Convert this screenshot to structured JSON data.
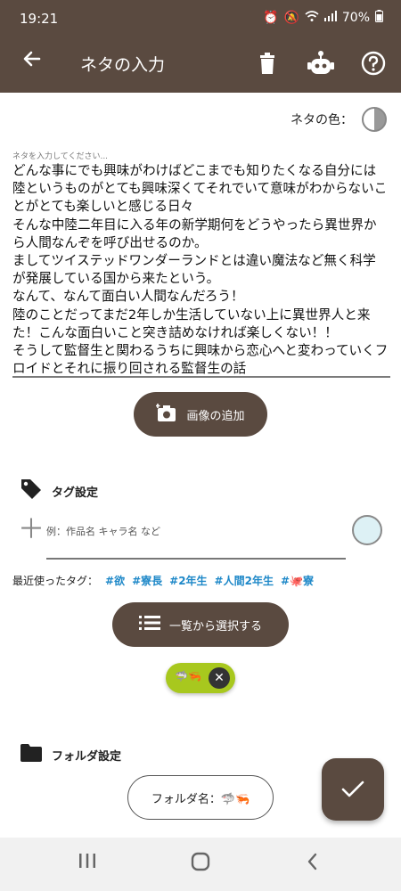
{
  "status_bar": {
    "time": "19:21",
    "battery": "70%"
  },
  "app_bar": {
    "title": "ネタの入力",
    "icons": [
      "back-arrow-icon",
      "trash-icon",
      "robot-icon",
      "help-icon"
    ]
  },
  "color_label": "ネタの色：",
  "memo": {
    "placeholder": "ネタを入力してください...",
    "text": "どんな事にでも興味がわけばどこまでも知りたくなる自分には陸というものがとても興味深くてそれでいて意味がわからないことがとても楽しいと感じる日々\nそんな中陸二年目に入る年の新学期何をどうやったら異世界から人間なんぞを呼び出せるのか。\nましてツイステッドワンダーランドとは違い魔法など無く科学が発展している国から来たという。\nなんて、なんて面白い人間なんだろう！\n陸のことだってまだ2年しか生活していない上に異世界人と来た！こんな面白いこと突き詰めなければ楽しくない！！\nそうして監督生と関わるうちに興味から恋心へと変わっていくフロイドとそれに振り回される監督生の話"
  },
  "add_image_label": "画像の追加",
  "tag_section": {
    "title": "タグ設定",
    "input_placeholder": "例：作品名 キャラ名 など",
    "recent_label": "最近使ったタグ：",
    "recent_tags": [
      "#欲",
      "#寮長",
      "#2年生",
      "#人間2年生",
      "#🐙寮"
    ],
    "select_list_label": "一覧から選択する",
    "chip_label": "🦈🦐"
  },
  "folder_section": {
    "title": "フォルダ設定",
    "button_label": "フォルダ名：🦈🦐"
  },
  "colors": {
    "primary": "#5a4a40",
    "tag_link": "#1e88c8",
    "chip": "#a8c81e",
    "tag_color_circle": "#ddf1f5"
  }
}
